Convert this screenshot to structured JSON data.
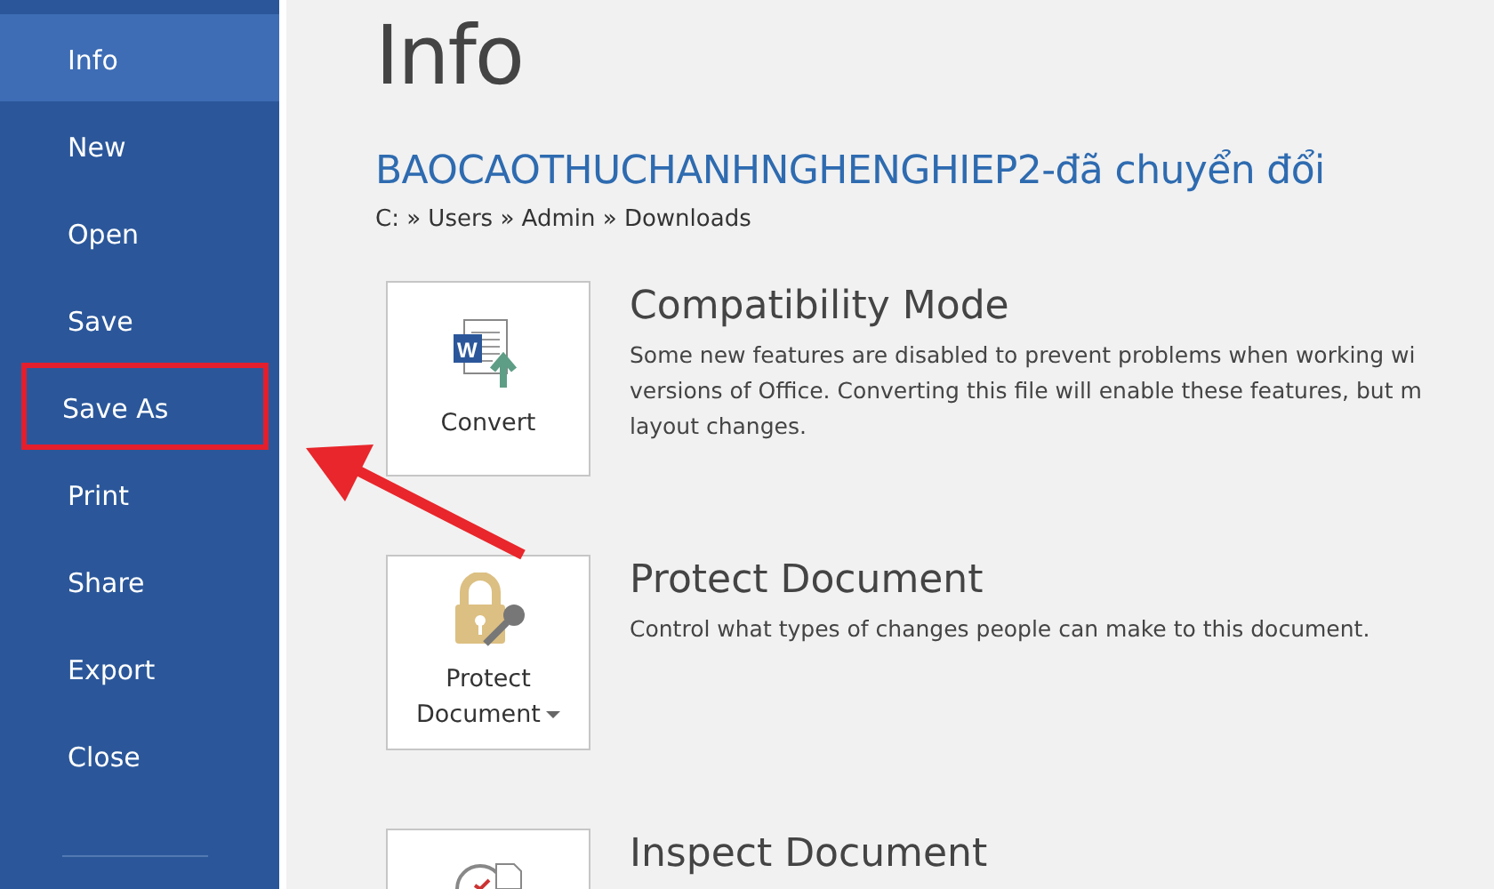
{
  "sidebar": {
    "items": [
      {
        "label": "Info",
        "selected": true,
        "highlighted": false
      },
      {
        "label": "New",
        "selected": false,
        "highlighted": false
      },
      {
        "label": "Open",
        "selected": false,
        "highlighted": false
      },
      {
        "label": "Save",
        "selected": false,
        "highlighted": false
      },
      {
        "label": "Save As",
        "selected": false,
        "highlighted": true
      },
      {
        "label": "Print",
        "selected": false,
        "highlighted": false
      },
      {
        "label": "Share",
        "selected": false,
        "highlighted": false
      },
      {
        "label": "Export",
        "selected": false,
        "highlighted": false
      },
      {
        "label": "Close",
        "selected": false,
        "highlighted": false
      }
    ]
  },
  "page": {
    "title": "Info",
    "file_name": "BAOCAOTHUCHANHNGHENGHIEP2-đã chuyển đổi",
    "path": "C: » Users » Admin » Downloads"
  },
  "sections": [
    {
      "kind": "convert",
      "icon_text": "W",
      "button": "Convert",
      "dropdown": false,
      "title": "Compatibility Mode",
      "description": [
        "Some new features are disabled to prevent problems when working wi",
        "versions of Office. Converting this file will enable these features, but m",
        "layout changes."
      ]
    },
    {
      "kind": "protect",
      "button": "Protect Document",
      "dropdown": true,
      "title": "Protect Document",
      "description": [
        "Control what types of changes people can make to this document."
      ]
    },
    {
      "kind": "inspect",
      "title": "Inspect Document"
    }
  ]
}
